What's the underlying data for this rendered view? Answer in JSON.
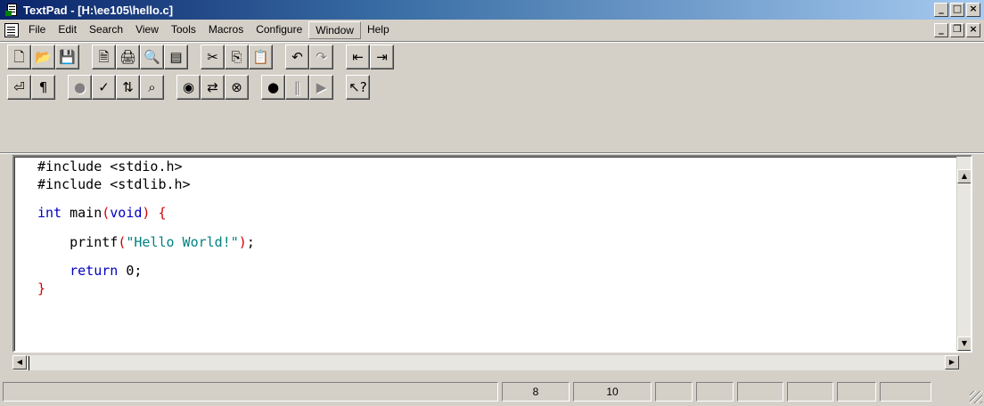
{
  "window": {
    "title": "TextPad - [H:\\ee105\\hello.c]",
    "buttons": [
      "_",
      "□",
      "×"
    ]
  },
  "menubar": {
    "items": [
      {
        "label": "File",
        "active": false
      },
      {
        "label": "Edit",
        "active": false
      },
      {
        "label": "Search",
        "active": false
      },
      {
        "label": "View",
        "active": false
      },
      {
        "label": "Tools",
        "active": false
      },
      {
        "label": "Macros",
        "active": false
      },
      {
        "label": "Configure",
        "active": false
      },
      {
        "label": "Window",
        "active": true
      },
      {
        "label": "Help",
        "active": false
      }
    ],
    "mdi_buttons": [
      "_",
      "❐",
      "×"
    ]
  },
  "toolbar1": {
    "groups": [
      [
        {
          "name": "new",
          "glyph": "🗋"
        },
        {
          "name": "open",
          "glyph": "📂"
        },
        {
          "name": "save",
          "glyph": "💾"
        }
      ],
      [
        {
          "name": "print",
          "glyph": "🗎"
        },
        {
          "name": "print-preview",
          "glyph": "🖨"
        },
        {
          "name": "find-preview",
          "glyph": "🔍"
        },
        {
          "name": "document-properties",
          "glyph": "▤"
        }
      ],
      [
        {
          "name": "cut",
          "glyph": "✂"
        },
        {
          "name": "copy",
          "glyph": "⎘"
        },
        {
          "name": "paste",
          "glyph": "📋"
        }
      ],
      [
        {
          "name": "undo",
          "glyph": "↶"
        },
        {
          "name": "redo",
          "glyph": "↷"
        }
      ],
      [
        {
          "name": "decrease-indent",
          "glyph": "⇤"
        },
        {
          "name": "increase-indent",
          "glyph": "⇥"
        }
      ]
    ]
  },
  "toolbar2": {
    "groups": [
      [
        {
          "name": "word-wrap",
          "glyph": "⏎"
        },
        {
          "name": "visible-spaces",
          "glyph": "¶"
        }
      ],
      [
        {
          "name": "spell-check-disabled",
          "glyph": "●"
        },
        {
          "name": "spell-check",
          "glyph": "✓"
        },
        {
          "name": "sort",
          "glyph": "⇅"
        },
        {
          "name": "find-in-files",
          "glyph": "⌕"
        }
      ],
      [
        {
          "name": "view-in-browser",
          "glyph": "◉"
        },
        {
          "name": "find-replace",
          "glyph": "⇄"
        },
        {
          "name": "find-binoculars",
          "glyph": "⊗"
        }
      ],
      [
        {
          "name": "record-macro",
          "glyph": "●"
        },
        {
          "name": "pause-macro",
          "glyph": "‖"
        },
        {
          "name": "play-macro",
          "glyph": "▶"
        }
      ],
      [
        {
          "name": "context-help",
          "glyph": "↖?"
        }
      ]
    ]
  },
  "editor": {
    "lines": [
      "#include <stdio.h>",
      "#include <stdlib.h>",
      "",
      "int main(void) {",
      "",
      "    printf(\"Hello World!\");",
      "",
      "    return 0;",
      "}"
    ]
  },
  "statusbar": {
    "line": "8",
    "column": "10"
  },
  "colors": {
    "keyword": "#0000c0",
    "string": "#008080",
    "brace": "#d00000",
    "titlebar": "#0a246a"
  }
}
